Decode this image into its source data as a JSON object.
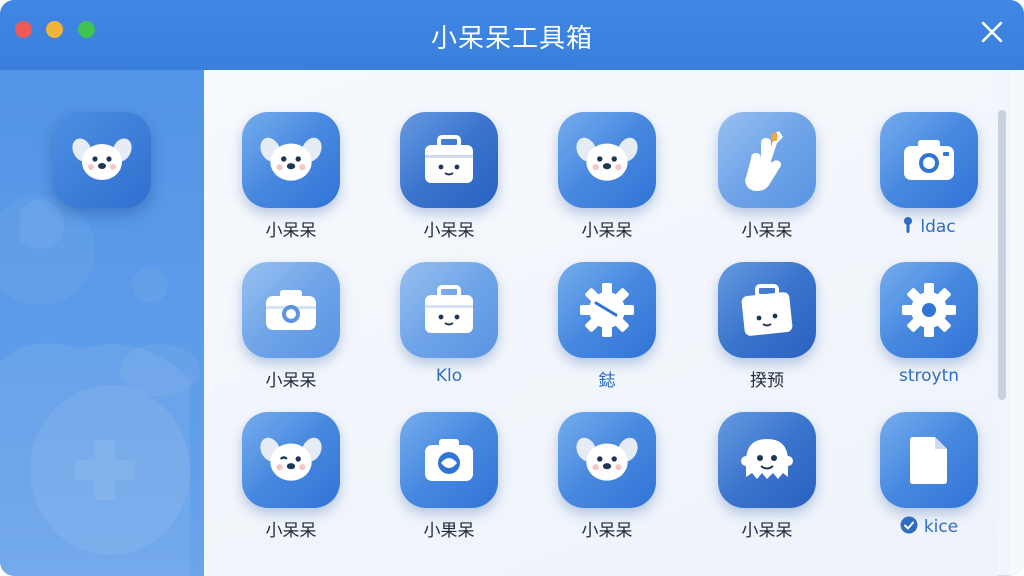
{
  "window": {
    "title": "小呆呆工具箱",
    "controls": [
      "close-window-red",
      "minimize-window-yellow",
      "zoom-window-green"
    ],
    "close_icon": "close-icon"
  },
  "colors": {
    "titlebar": "#3f87e3",
    "sidebar": "#5a9ae7",
    "tile_primary": "#3274d6",
    "label_text": "#1f2a3a",
    "label_blue": "#2f6cc4"
  },
  "sidebar": {
    "app": {
      "icon": "puppy-face-icon"
    }
  },
  "grid": {
    "rows": [
      [
        {
          "label": "小呆呆",
          "icon": "puppy-face-icon"
        },
        {
          "label": "小呆呆",
          "icon": "toolbox-icon"
        },
        {
          "label": "小呆呆",
          "icon": "puppy-face-icon"
        },
        {
          "label": "小呆呆",
          "icon": "hand-wrench-icon"
        },
        {
          "label": "ldac",
          "icon": "camera-icon",
          "prefix_icon": "pin-icon"
        }
      ],
      [
        {
          "label": "小呆呆",
          "icon": "camera-icon"
        },
        {
          "label": "Klo",
          "icon": "toolbox-icon"
        },
        {
          "label": "鋕",
          "icon": "gear-icon"
        },
        {
          "label": "揆预",
          "icon": "toolbox-icon"
        },
        {
          "label": "stroytn",
          "icon": "gear-icon"
        }
      ],
      [
        {
          "label": "小呆呆",
          "icon": "puppy-face-icon"
        },
        {
          "label": "小果呆",
          "icon": "camera-icon"
        },
        {
          "label": "小呆呆",
          "icon": "puppy-face-icon"
        },
        {
          "label": "小呆呆",
          "icon": "ghost-face-icon"
        },
        {
          "label": "kice",
          "icon": "document-icon",
          "prefix_icon": "check-circle-icon"
        }
      ]
    ]
  }
}
